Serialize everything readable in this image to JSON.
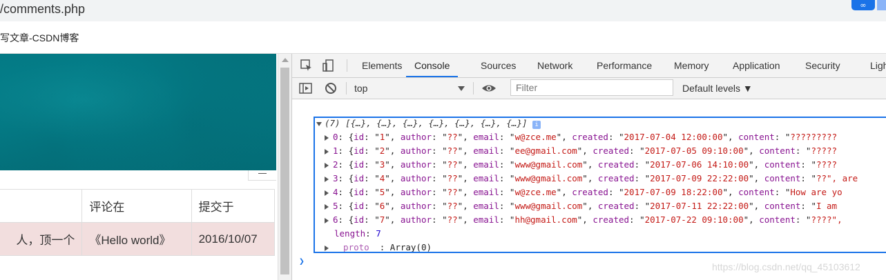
{
  "browser": {
    "url": "/comments.php",
    "bookmark": "写文章-CSDN博客"
  },
  "page": {
    "table": {
      "headers": [
        "",
        "评论在",
        "提交于"
      ],
      "rows": [
        {
          "comment": "人，顶一个",
          "post": "《Hello world》",
          "date": "2016/10/07"
        }
      ]
    }
  },
  "devtools": {
    "tabs": [
      "Elements",
      "Console",
      "Sources",
      "Network",
      "Performance",
      "Memory",
      "Application",
      "Security",
      "Ligh"
    ],
    "active_tab": "Console",
    "context": "top",
    "filter_placeholder": "Filter",
    "levels": "Default levels ▼",
    "console": {
      "summary": "(7) [{…}, {…}, {…}, {…}, {…}, {…}, {…}]",
      "entries": [
        {
          "idx": "0",
          "id": "1",
          "author": "??",
          "email": "w@zce.me",
          "created": "2017-07-04 12:00:00",
          "content": "?????????"
        },
        {
          "idx": "1",
          "id": "2",
          "author": "??",
          "email": "ee@gmail.com",
          "created": "2017-07-05 09:10:00",
          "content": "?????"
        },
        {
          "idx": "2",
          "id": "3",
          "author": "??",
          "email": "www@gmail.com",
          "created": "2017-07-06 14:10:00",
          "content": "????"
        },
        {
          "idx": "3",
          "id": "4",
          "author": "??",
          "email": "www@gmail.com",
          "created": "2017-07-09 22:22:00",
          "content": "??\", are"
        },
        {
          "idx": "4",
          "id": "5",
          "author": "??",
          "email": "w@zce.me",
          "created": "2017-07-09 18:22:00",
          "content": "How are yo"
        },
        {
          "idx": "5",
          "id": "6",
          "author": "??",
          "email": "www@gmail.com",
          "created": "2017-07-11 22:22:00",
          "content": "I am"
        },
        {
          "idx": "6",
          "id": "7",
          "author": "??",
          "email": "hh@gmail.com",
          "created": "2017-07-22 09:10:00",
          "content": "????\","
        }
      ],
      "length_label": "length",
      "length_value": "7",
      "proto_label": "__proto__",
      "proto_value": "Array(0)"
    },
    "watermark": "https://blog.csdn.net/qq_45103612"
  },
  "colors": {
    "accent": "#1a73e8",
    "hero": "#047f8a",
    "highlight_row": "#f2dede"
  }
}
